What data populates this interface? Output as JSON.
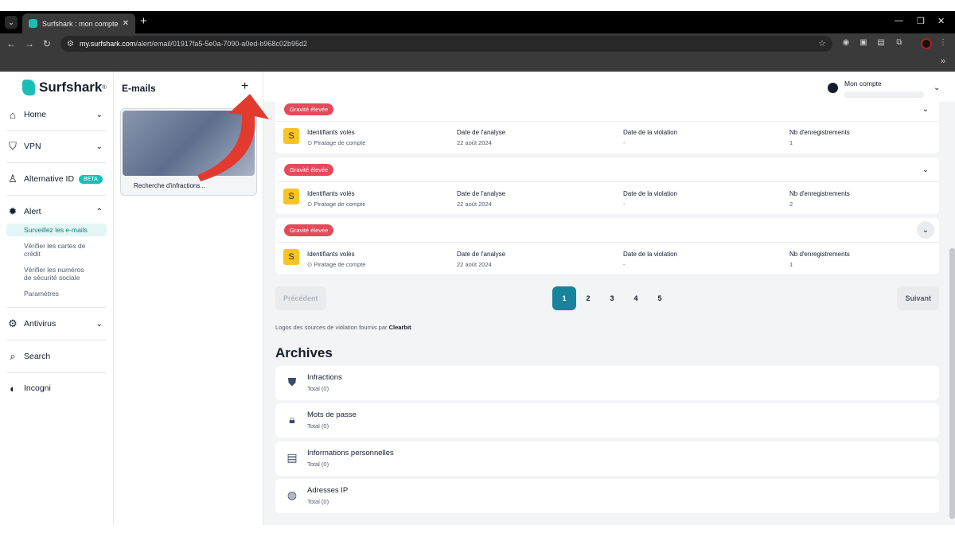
{
  "browser": {
    "tab_title": "Surfshark : mon compte",
    "url_host": "my.surfshark.com",
    "url_path": "/alert/email/01917fa5-5e0a-7090-a0ed-b968c02b95d2"
  },
  "sidebar": {
    "brand": "Surfshark",
    "items": [
      {
        "label": "Home",
        "icon": "home-icon"
      },
      {
        "label": "VPN",
        "icon": "shield-icon"
      },
      {
        "label": "Alternative ID",
        "icon": "person-icon",
        "badge": "BETA"
      },
      {
        "label": "Alert",
        "icon": "bug-icon"
      },
      {
        "label": "Antivirus",
        "icon": "gear-icon"
      },
      {
        "label": "Search",
        "icon": "search-icon"
      },
      {
        "label": "Incogni",
        "icon": "toggle-icon"
      }
    ],
    "alert_sub": [
      "Surveillez les e-mails",
      "Vérifier les cartes de crédit",
      "Vérifier les numéros de sécurité sociale",
      "Paramètres"
    ]
  },
  "emails": {
    "header": "E-mails",
    "card_caption": "Recherche d'infractions..."
  },
  "account": {
    "label": "Mon compte"
  },
  "breaches": [
    {
      "severity": "Gravité élevée",
      "source_letter": "S",
      "title": "Identifiants volés",
      "type": "Piratage de compte",
      "scan_label": "Date de l'analyse",
      "scan_date": "22 août 2024",
      "violation_label": "Date de la violation",
      "violation_date": "-",
      "records_label": "Nb d'enregistrements",
      "records": "1"
    },
    {
      "severity": "Gravité élevée",
      "source_letter": "S",
      "title": "Identifiants volés",
      "type": "Piratage de compte",
      "scan_label": "Date de l'analyse",
      "scan_date": "22 août 2024",
      "violation_label": "Date de la violation",
      "violation_date": "-",
      "records_label": "Nb d'enregistrements",
      "records": "2"
    },
    {
      "severity": "Gravité élevée",
      "source_letter": "S",
      "title": "Identifiants volés",
      "type": "Piratage de compte",
      "scan_label": "Date de l'analyse",
      "scan_date": "22 août 2024",
      "violation_label": "Date de la violation",
      "violation_date": "-",
      "records_label": "Nb d'enregistrements",
      "records": "1"
    }
  ],
  "pagination": {
    "prev": "Précédent",
    "next": "Suivant",
    "pages": [
      "1",
      "2",
      "3",
      "4",
      "5"
    ],
    "current": "1"
  },
  "credit": {
    "text": "Logos des sources de violation fournis par",
    "brand": "Clearbit",
    "end": "."
  },
  "archives": {
    "title": "Archives",
    "items": [
      {
        "title": "Infractions",
        "total": "Total (0)",
        "icon": "shield-alert-icon"
      },
      {
        "title": "Mots de passe",
        "total": "Total (0)",
        "icon": "lock-icon"
      },
      {
        "title": "Informations personnelles",
        "total": "Total (0)",
        "icon": "id-document-icon"
      },
      {
        "title": "Adresses IP",
        "total": "Total (0)",
        "icon": "globe-icon"
      }
    ]
  },
  "colors": {
    "accent": "#1cbdb5",
    "severity": "#e34a5a",
    "page_active": "#17849b",
    "annotation_arrow": "#e23a2e"
  }
}
